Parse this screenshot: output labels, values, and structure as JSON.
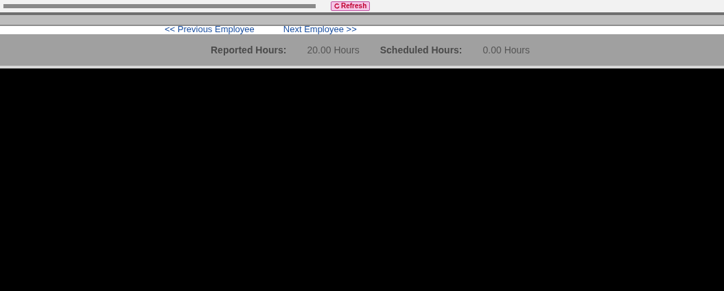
{
  "toolbar": {
    "refresh_button": "Refresh"
  },
  "navigation": {
    "previous": "<< Previous Employee",
    "next": "Next Employee >>"
  },
  "summary": [
    {
      "label": "Reported Hours:",
      "value": "20.00 Hours"
    },
    {
      "label": "Scheduled Hours:",
      "value": "0.00 Hours"
    }
  ]
}
